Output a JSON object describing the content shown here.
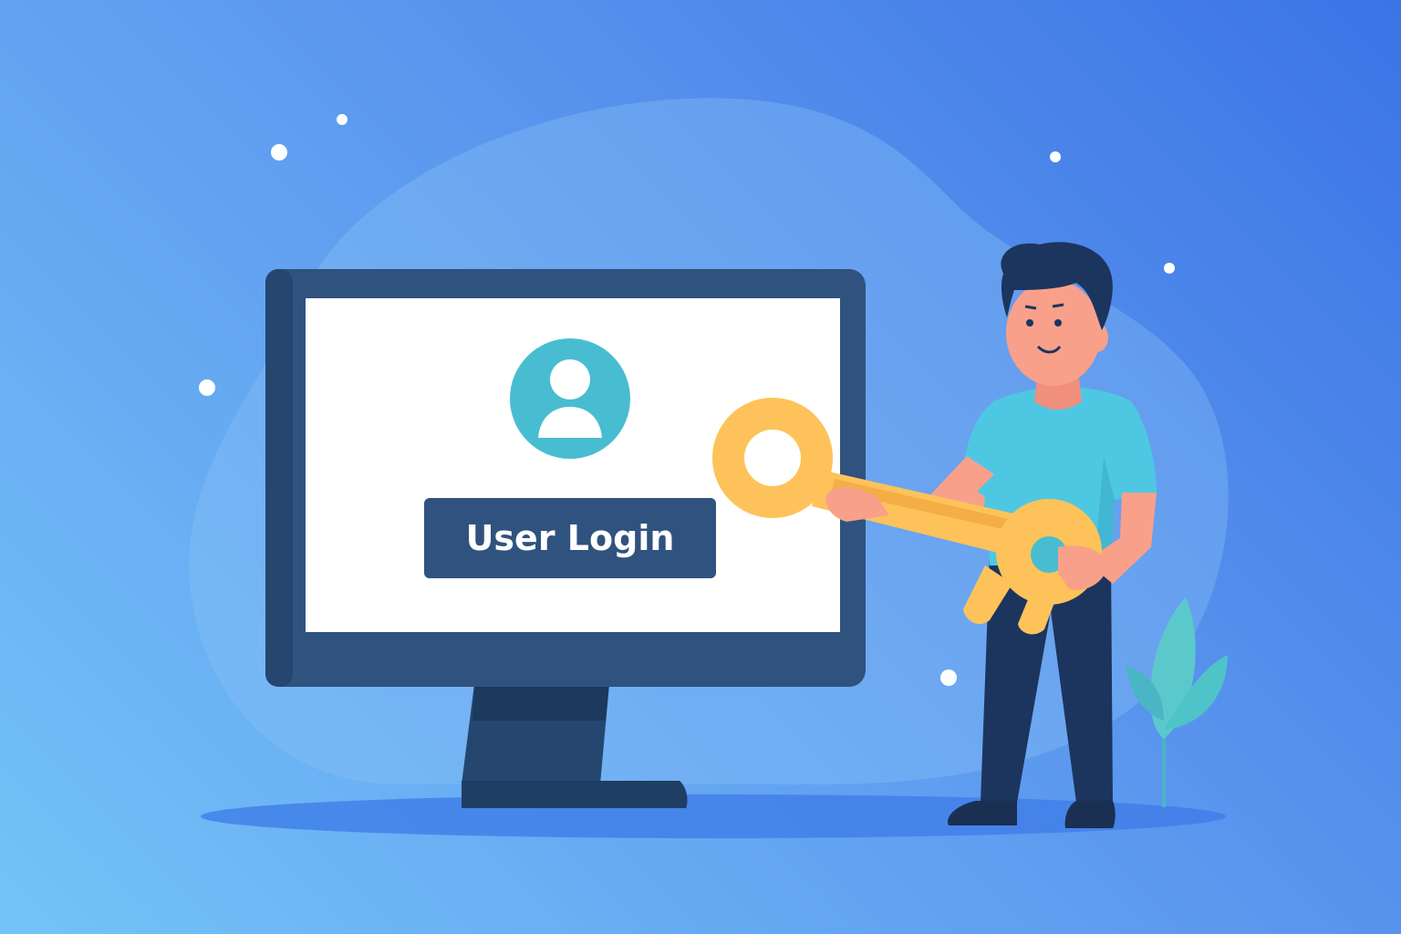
{
  "screen": {
    "login_button_label": "User Login"
  },
  "colors": {
    "background_start": "#74c3f8",
    "background_end": "#3b74e6",
    "monitor_frame": "#30527e",
    "monitor_screen": "#ffffff",
    "avatar_circle": "#48bdd1",
    "login_button": "#30527e",
    "key": "#fdc35a",
    "shirt": "#4ec8e2",
    "pants": "#1c355e",
    "skin": "#f9a08a",
    "hair": "#1c355e",
    "plant": "#5bc9cc"
  },
  "icons": [
    "user-avatar-icon",
    "key-icon",
    "plant-icon",
    "sparkle-dot-icon"
  ]
}
